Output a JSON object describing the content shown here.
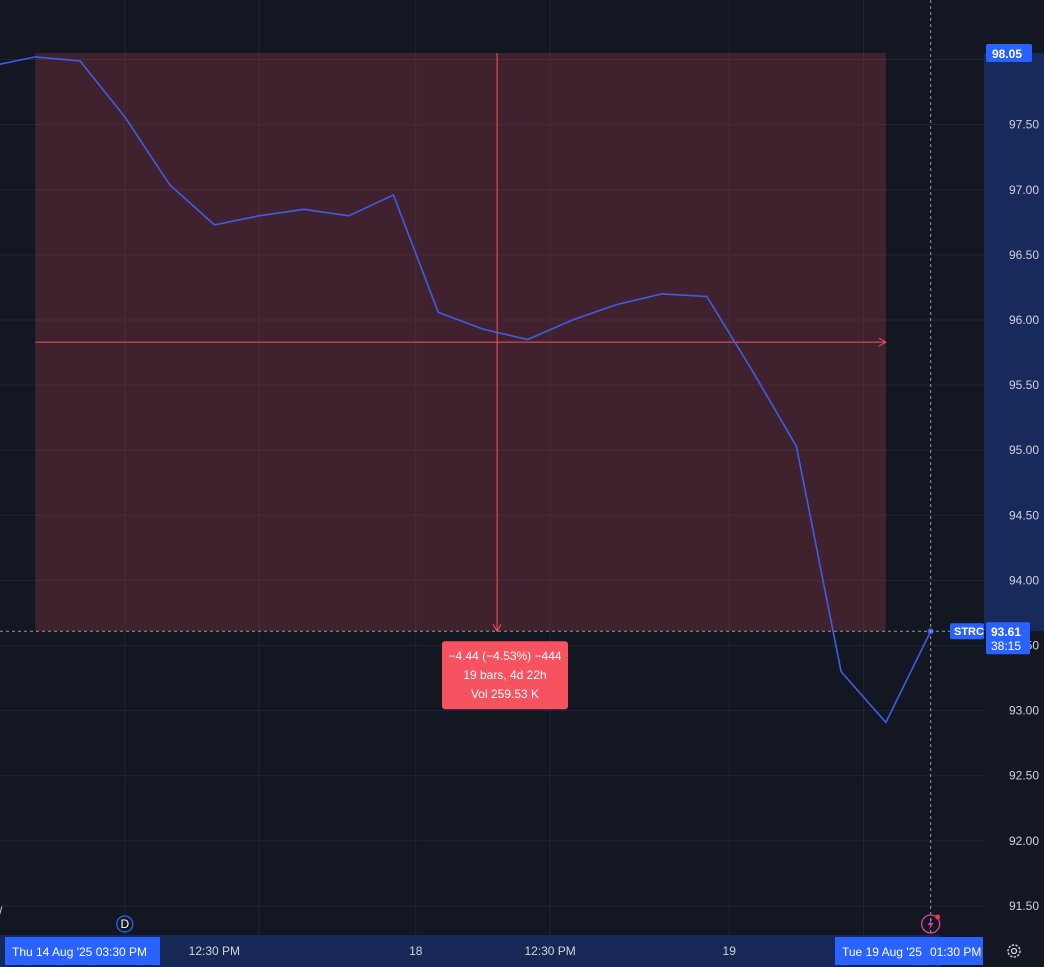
{
  "chart_data": {
    "type": "line",
    "symbol": "STRC",
    "y_axis": {
      "min": 91.3,
      "max": 98.25,
      "ticks": [
        "91.50",
        "92.00",
        "92.50",
        "93.00",
        "93.50",
        "94.00",
        "94.50",
        "95.00",
        "95.50",
        "96.00",
        "96.50",
        "97.00",
        "97.50",
        "98.00"
      ]
    },
    "x_labels": [
      {
        "label": "12:30 PM",
        "bar": 5
      },
      {
        "label": "18",
        "bar": 9.5
      },
      {
        "label": "12:30 PM",
        "bar": 12.5
      },
      {
        "label": "19",
        "bar": 16.5
      }
    ],
    "series": [
      {
        "values": [
          97.95,
          98.02,
          97.99,
          97.56,
          97.04,
          96.73,
          96.8,
          96.85,
          96.8,
          96.96,
          96.06,
          95.93,
          95.85,
          96.0,
          96.12,
          96.2,
          96.18,
          95.62,
          95.03,
          93.3,
          92.91,
          93.61
        ]
      }
    ],
    "measure": {
      "start_bar": 1.0,
      "end_bar": 20.0,
      "start_price": 98.05,
      "end_price": 93.61,
      "line1": "−4.44 (−4.53%) −444",
      "line2": "19 bars, 4d 22h",
      "line3": "Vol 259.53 K",
      "color": "#f7525f"
    },
    "crosshair": {
      "bar": 10.4,
      "price": 95.83,
      "y_label": "93.61",
      "countdown": "38:15"
    },
    "labels": {
      "top_price": "98.05",
      "current_price": "93.61",
      "countdown": "38:15",
      "x_start": "Thu 14 Aug '25   03:30 PM",
      "x_end_date": "Tue 19 Aug '25",
      "x_end_time": "01:30 PM",
      "d_marker": "D"
    },
    "colors": {
      "background": "#131722",
      "line": "#3f5ce8",
      "measure_fill": "#f7525f",
      "tag_blue": "#2962ff",
      "grid": "#1e2433"
    }
  }
}
